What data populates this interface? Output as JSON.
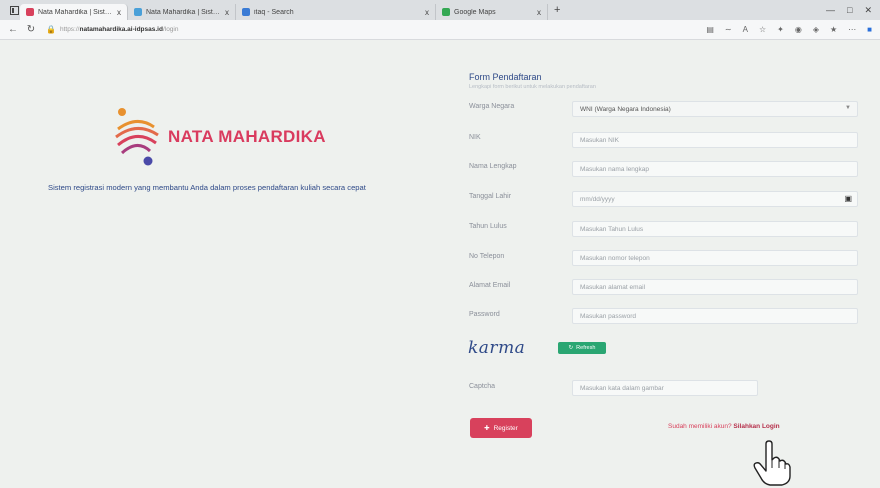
{
  "browser": {
    "tabs": [
      {
        "title": "Nata Mahardika | Sistem Manaj",
        "close": "x",
        "active": true,
        "color": "#d8415c"
      },
      {
        "title": "Nata Mahardika | Sistem Manaj",
        "close": "x",
        "active": false,
        "color": "#4aa0d8"
      },
      {
        "title": "itaq - Search",
        "close": "x",
        "active": false,
        "color": "#3a7bd5"
      },
      {
        "title": "Google Maps",
        "close": "x",
        "active": false,
        "color": "#34a853"
      }
    ],
    "new_tab": "+",
    "url_prefix": "https://",
    "url_host": "natamahardika.ai-idpsas.id",
    "url_path": "/login"
  },
  "brand": {
    "name": "NATA MAHARDIKA",
    "tagline": "Sistem registrasi modern yang membantu Anda dalam proses pendaftaran kuliah secara cepat"
  },
  "form": {
    "title": "Form Pendaftaran",
    "subtitle": "Lengkapi form berikut untuk melakukan pendaftaran",
    "warga_negara": {
      "label": "Warga Negara",
      "value": "WNI (Warga Negara Indonesia)"
    },
    "nik": {
      "label": "NIK",
      "placeholder": "Masukan NIK"
    },
    "nama": {
      "label": "Nama Lengkap",
      "placeholder": "Masukan nama lengkap"
    },
    "tanggal_lahir": {
      "label": "Tanggal Lahir",
      "placeholder": "mm/dd/yyyy"
    },
    "tahun_lulus": {
      "label": "Tahun Lulus",
      "placeholder": "Masukan Tahun Lulus"
    },
    "no_telepon": {
      "label": "No Telepon",
      "placeholder": "Masukan nomor telepon"
    },
    "email": {
      "label": "Alamat Email",
      "placeholder": "Masukan alamat email"
    },
    "password": {
      "label": "Password",
      "placeholder": "Masukan password"
    },
    "captcha_text": "karma",
    "refresh_label": "Refresh",
    "captcha": {
      "label": "Captcha",
      "placeholder": "Masukan kata dalam gambar"
    },
    "register_label": "Register",
    "login_prompt": "Sudah memiliki akun? ",
    "login_link": "Silahkan Login"
  },
  "colors": {
    "accent": "#d8415c",
    "navy": "#2f4a88",
    "green": "#2aa672"
  }
}
